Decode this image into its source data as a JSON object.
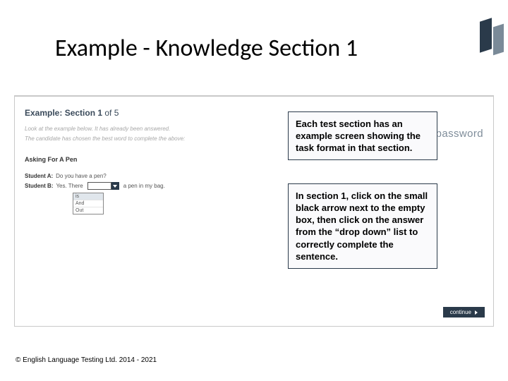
{
  "title": "Example - Knowledge Section 1",
  "example": {
    "heading_bold": "Example: Section 1",
    "heading_rest": " of 5",
    "sub1": "Look at the example below. It has already been answered.",
    "sub2": "The candidate has chosen the best word to complete the above:",
    "task_title": "Asking For A Pen",
    "lineA_label": "Student A:",
    "lineA_text": "Do you have a pen?",
    "lineB_label": "Student B:",
    "lineB_before": "Yes. There",
    "lineB_after": "a pen in my bag.",
    "options": [
      "is",
      "And",
      "Out"
    ]
  },
  "brand": "password",
  "callout1": "Each test section has an example screen showing the task format in that section.",
  "callout2": "In section 1, click on the small black arrow next to the empty box, then click on the answer from the “drop down” list to correctly complete the sentence.",
  "continue_label": "continue",
  "copyright": "© English Language Testing Ltd. 2014 - 2021"
}
